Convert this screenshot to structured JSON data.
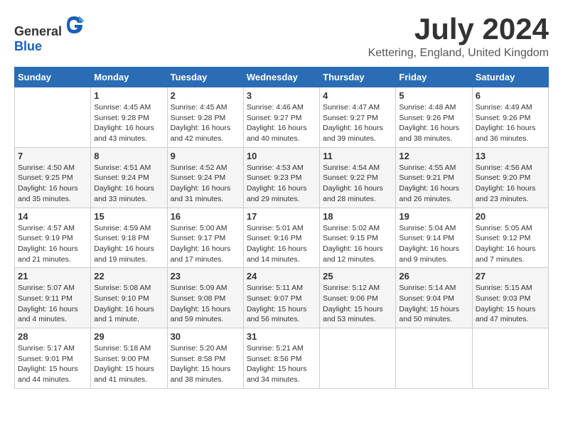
{
  "header": {
    "logo_general": "General",
    "logo_blue": "Blue",
    "month_year": "July 2024",
    "location": "Kettering, England, United Kingdom"
  },
  "weekdays": [
    "Sunday",
    "Monday",
    "Tuesday",
    "Wednesday",
    "Thursday",
    "Friday",
    "Saturday"
  ],
  "weeks": [
    [
      {
        "day": "",
        "sunrise": "",
        "sunset": "",
        "daylight": ""
      },
      {
        "day": "1",
        "sunrise": "Sunrise: 4:45 AM",
        "sunset": "Sunset: 9:28 PM",
        "daylight": "Daylight: 16 hours and 43 minutes."
      },
      {
        "day": "2",
        "sunrise": "Sunrise: 4:45 AM",
        "sunset": "Sunset: 9:28 PM",
        "daylight": "Daylight: 16 hours and 42 minutes."
      },
      {
        "day": "3",
        "sunrise": "Sunrise: 4:46 AM",
        "sunset": "Sunset: 9:27 PM",
        "daylight": "Daylight: 16 hours and 40 minutes."
      },
      {
        "day": "4",
        "sunrise": "Sunrise: 4:47 AM",
        "sunset": "Sunset: 9:27 PM",
        "daylight": "Daylight: 16 hours and 39 minutes."
      },
      {
        "day": "5",
        "sunrise": "Sunrise: 4:48 AM",
        "sunset": "Sunset: 9:26 PM",
        "daylight": "Daylight: 16 hours and 38 minutes."
      },
      {
        "day": "6",
        "sunrise": "Sunrise: 4:49 AM",
        "sunset": "Sunset: 9:26 PM",
        "daylight": "Daylight: 16 hours and 36 minutes."
      }
    ],
    [
      {
        "day": "7",
        "sunrise": "Sunrise: 4:50 AM",
        "sunset": "Sunset: 9:25 PM",
        "daylight": "Daylight: 16 hours and 35 minutes."
      },
      {
        "day": "8",
        "sunrise": "Sunrise: 4:51 AM",
        "sunset": "Sunset: 9:24 PM",
        "daylight": "Daylight: 16 hours and 33 minutes."
      },
      {
        "day": "9",
        "sunrise": "Sunrise: 4:52 AM",
        "sunset": "Sunset: 9:24 PM",
        "daylight": "Daylight: 16 hours and 31 minutes."
      },
      {
        "day": "10",
        "sunrise": "Sunrise: 4:53 AM",
        "sunset": "Sunset: 9:23 PM",
        "daylight": "Daylight: 16 hours and 29 minutes."
      },
      {
        "day": "11",
        "sunrise": "Sunrise: 4:54 AM",
        "sunset": "Sunset: 9:22 PM",
        "daylight": "Daylight: 16 hours and 28 minutes."
      },
      {
        "day": "12",
        "sunrise": "Sunrise: 4:55 AM",
        "sunset": "Sunset: 9:21 PM",
        "daylight": "Daylight: 16 hours and 26 minutes."
      },
      {
        "day": "13",
        "sunrise": "Sunrise: 4:56 AM",
        "sunset": "Sunset: 9:20 PM",
        "daylight": "Daylight: 16 hours and 23 minutes."
      }
    ],
    [
      {
        "day": "14",
        "sunrise": "Sunrise: 4:57 AM",
        "sunset": "Sunset: 9:19 PM",
        "daylight": "Daylight: 16 hours and 21 minutes."
      },
      {
        "day": "15",
        "sunrise": "Sunrise: 4:59 AM",
        "sunset": "Sunset: 9:18 PM",
        "daylight": "Daylight: 16 hours and 19 minutes."
      },
      {
        "day": "16",
        "sunrise": "Sunrise: 5:00 AM",
        "sunset": "Sunset: 9:17 PM",
        "daylight": "Daylight: 16 hours and 17 minutes."
      },
      {
        "day": "17",
        "sunrise": "Sunrise: 5:01 AM",
        "sunset": "Sunset: 9:16 PM",
        "daylight": "Daylight: 16 hours and 14 minutes."
      },
      {
        "day": "18",
        "sunrise": "Sunrise: 5:02 AM",
        "sunset": "Sunset: 9:15 PM",
        "daylight": "Daylight: 16 hours and 12 minutes."
      },
      {
        "day": "19",
        "sunrise": "Sunrise: 5:04 AM",
        "sunset": "Sunset: 9:14 PM",
        "daylight": "Daylight: 16 hours and 9 minutes."
      },
      {
        "day": "20",
        "sunrise": "Sunrise: 5:05 AM",
        "sunset": "Sunset: 9:12 PM",
        "daylight": "Daylight: 16 hours and 7 minutes."
      }
    ],
    [
      {
        "day": "21",
        "sunrise": "Sunrise: 5:07 AM",
        "sunset": "Sunset: 9:11 PM",
        "daylight": "Daylight: 16 hours and 4 minutes."
      },
      {
        "day": "22",
        "sunrise": "Sunrise: 5:08 AM",
        "sunset": "Sunset: 9:10 PM",
        "daylight": "Daylight: 16 hours and 1 minute."
      },
      {
        "day": "23",
        "sunrise": "Sunrise: 5:09 AM",
        "sunset": "Sunset: 9:08 PM",
        "daylight": "Daylight: 15 hours and 59 minutes."
      },
      {
        "day": "24",
        "sunrise": "Sunrise: 5:11 AM",
        "sunset": "Sunset: 9:07 PM",
        "daylight": "Daylight: 15 hours and 56 minutes."
      },
      {
        "day": "25",
        "sunrise": "Sunrise: 5:12 AM",
        "sunset": "Sunset: 9:06 PM",
        "daylight": "Daylight: 15 hours and 53 minutes."
      },
      {
        "day": "26",
        "sunrise": "Sunrise: 5:14 AM",
        "sunset": "Sunset: 9:04 PM",
        "daylight": "Daylight: 15 hours and 50 minutes."
      },
      {
        "day": "27",
        "sunrise": "Sunrise: 5:15 AM",
        "sunset": "Sunset: 9:03 PM",
        "daylight": "Daylight: 15 hours and 47 minutes."
      }
    ],
    [
      {
        "day": "28",
        "sunrise": "Sunrise: 5:17 AM",
        "sunset": "Sunset: 9:01 PM",
        "daylight": "Daylight: 15 hours and 44 minutes."
      },
      {
        "day": "29",
        "sunrise": "Sunrise: 5:18 AM",
        "sunset": "Sunset: 9:00 PM",
        "daylight": "Daylight: 15 hours and 41 minutes."
      },
      {
        "day": "30",
        "sunrise": "Sunrise: 5:20 AM",
        "sunset": "Sunset: 8:58 PM",
        "daylight": "Daylight: 15 hours and 38 minutes."
      },
      {
        "day": "31",
        "sunrise": "Sunrise: 5:21 AM",
        "sunset": "Sunset: 8:56 PM",
        "daylight": "Daylight: 15 hours and 34 minutes."
      },
      {
        "day": "",
        "sunrise": "",
        "sunset": "",
        "daylight": ""
      },
      {
        "day": "",
        "sunrise": "",
        "sunset": "",
        "daylight": ""
      },
      {
        "day": "",
        "sunrise": "",
        "sunset": "",
        "daylight": ""
      }
    ]
  ]
}
